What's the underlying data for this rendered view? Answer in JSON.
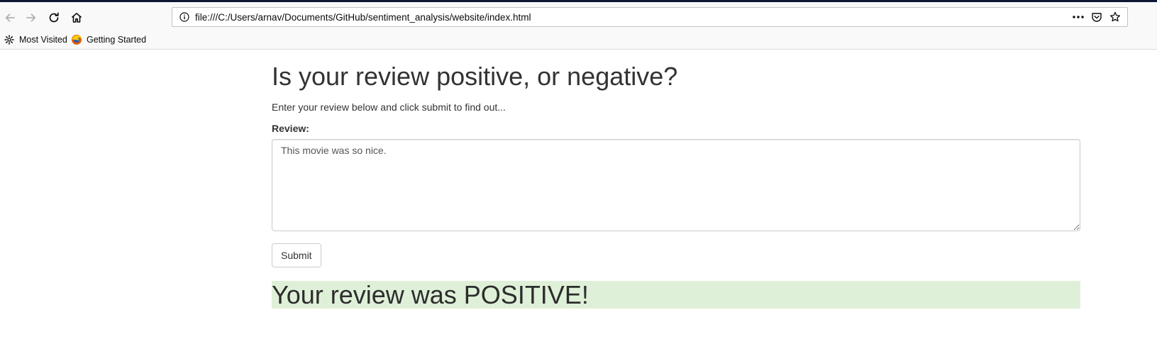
{
  "browser": {
    "url": "file:///C:/Users/arnav/Documents/GitHub/sentiment_analysis/website/index.html",
    "bookmarks": [
      {
        "label": "Most Visited"
      },
      {
        "label": "Getting Started"
      }
    ],
    "icons": {
      "back": "back-arrow-icon",
      "forward": "forward-arrow-icon",
      "reload": "reload-icon",
      "home": "home-icon",
      "info": "info-icon",
      "more": "more-actions-icon",
      "pocket": "pocket-icon",
      "bookmark": "star-icon"
    }
  },
  "page": {
    "title": "Is your review positive, or negative?",
    "intro": "Enter your review below and click submit to find out...",
    "review_label": "Review:",
    "review_value": "This movie was so nice.",
    "submit_label": "Submit",
    "result": "Your review was POSITIVE!",
    "result_color": "#dff0d8"
  }
}
